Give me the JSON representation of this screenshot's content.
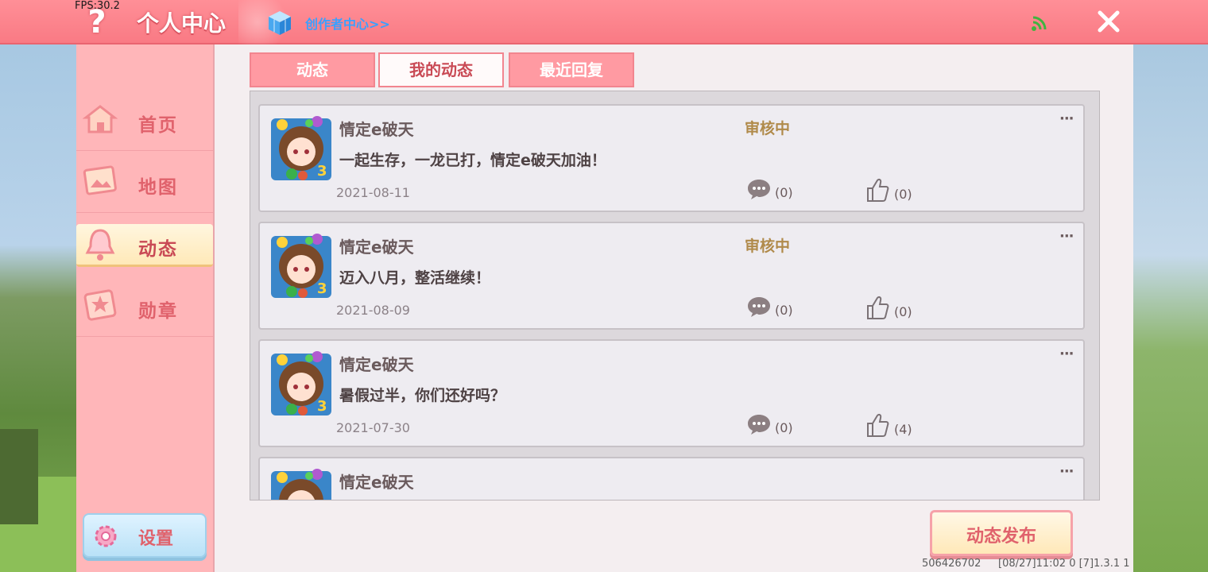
{
  "header": {
    "fps": "FPS:30.2",
    "help_glyph": "?",
    "title": "个人中心",
    "creator_link": "创作者中心>>"
  },
  "sidebar": {
    "items": [
      {
        "label": "首页",
        "icon": "home-icon"
      },
      {
        "label": "地图",
        "icon": "map-icon"
      },
      {
        "label": "动态",
        "icon": "bell-icon",
        "active": true
      },
      {
        "label": "勋章",
        "icon": "medal-icon"
      }
    ],
    "settings_label": "设置"
  },
  "tabs": [
    {
      "label": "动态"
    },
    {
      "label": "我的动态",
      "active": true
    },
    {
      "label": "最近回复"
    }
  ],
  "feed": [
    {
      "username": "情定e破天",
      "status": "审核中",
      "content": "一起生存，一龙已打，情定e破天加油！",
      "date": "2021-08-11",
      "comments": "(0)",
      "likes": "(0)"
    },
    {
      "username": "情定e破天",
      "status": "审核中",
      "content": "迈入八月，整活继续！",
      "date": "2021-08-09",
      "comments": "(0)",
      "likes": "(0)"
    },
    {
      "username": "情定e破天",
      "status": "",
      "content": "暑假过半，你们还好吗？",
      "date": "2021-07-30",
      "comments": "(0)",
      "likes": "(4)"
    },
    {
      "username": "情定e破天",
      "status": "",
      "content": "",
      "date": "",
      "comments": "",
      "likes": ""
    }
  ],
  "more_glyph": "···",
  "publish_label": "动态发布",
  "footer": {
    "id": "506426702",
    "info": "[08/27]11:02 0   [7]1.3.1  1"
  },
  "colors": {
    "header": "#f97a84",
    "sidebar": "#ffb6b9",
    "accent": "#e0626c",
    "status": "#b08a4a",
    "creator_link": "#3aa0ff"
  }
}
